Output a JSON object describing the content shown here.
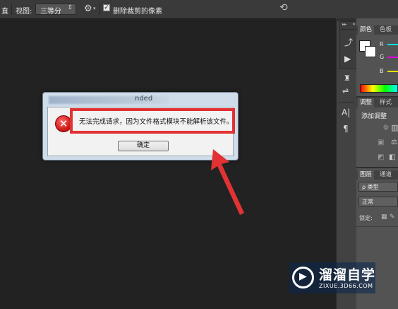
{
  "options_bar": {
    "left_cut_label": "直",
    "view_label": "视图:",
    "view_value": "三等分",
    "delete_cropped_label": "删除裁剪的像素",
    "delete_cropped_checked": true
  },
  "panels": {
    "color_tabs": [
      "颜色",
      "色板"
    ],
    "color_channels": [
      "R",
      "G",
      "B"
    ],
    "channel_colors": [
      "#00e0e0",
      "#e000e0",
      "#e0e000"
    ],
    "adjust_tabs": [
      "调整",
      "样式"
    ],
    "adjust_title": "添加调整",
    "layers_tabs": [
      "图层",
      "通道"
    ],
    "layers_filter": "ρ 类型",
    "blend_mode": "正常",
    "lock_label": "锁定:"
  },
  "dialog": {
    "title_fragment": "nded",
    "message": "无法完成请求，因为文件格式模块不能解析该文件。",
    "ok_label": "确定"
  },
  "annotation": {
    "color": "#e23234"
  },
  "watermark": {
    "main_text": "溜溜自学",
    "sub_text": "ZIXUE.3D66.COM"
  }
}
